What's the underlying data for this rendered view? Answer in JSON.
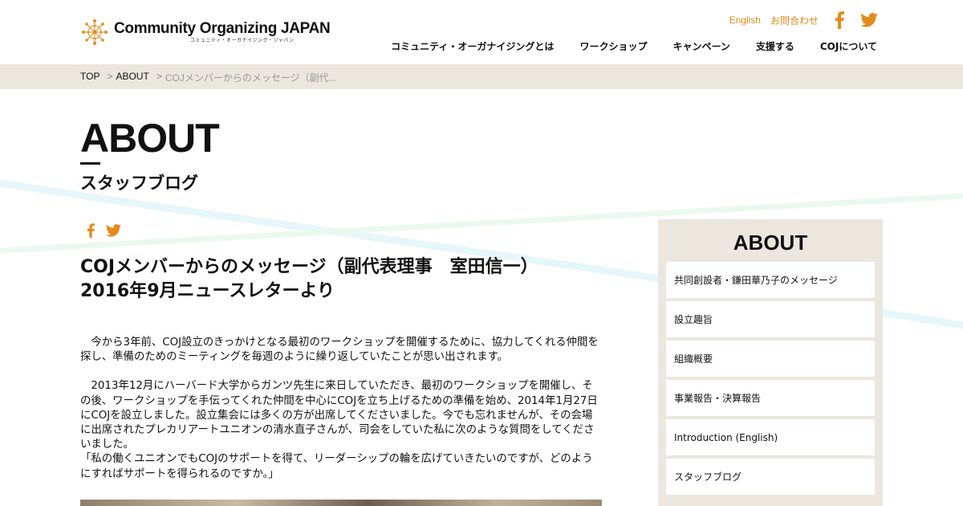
{
  "header": {
    "logo_main": "Community Organizing JAPAN",
    "logo_sub": "コミュニティ・オーガナイジング・ジャパン",
    "util_links": [
      "English",
      "お問合わせ"
    ],
    "icon_colors": {
      "accent": "#e38b1b"
    }
  },
  "nav": {
    "items": [
      "コミュニティ・オーガナイジングとは",
      "ワークショップ",
      "キャンペーン",
      "支援する",
      "COJについて"
    ]
  },
  "breadcrumb": {
    "top": "TOP",
    "about": "ABOUT",
    "current": "COJメンバーからのメッセージ（副代...",
    "sep": ">"
  },
  "page": {
    "title": "ABOUT",
    "subtitle": "スタッフブログ"
  },
  "article": {
    "title_line1": "COJメンバーからのメッセージ（副代表理事　室田信一）",
    "title_line2": "2016年9月ニュースレターより",
    "para1": "　今から3年前、COJ設立のきっかけとなる最初のワークショップを開催するために、協力してくれる仲間を探し、準備のためのミーティングを毎週のように繰り返していたことが思い出されます。",
    "para2": "　2013年12月にハーバード大学からガンツ先生に来日していただき、最初のワークショップを開催し、その後、ワークショップを手伝ってくれた仲間を中心にCOJを立ち上げるための準備を始め、2014年1月27日にCOJを設立しました。設立集会には多くの方が出席してくださいました。今でも忘れませんが、その会場に出席されたプレカリアートユニオンの清水直子さんが、司会をしていた私に次のような質問をしてくださいました。",
    "para3": "「私の働くユニオンでもCOJのサポートを得て、リーダーシップの輪を広げていきたいのですが、どのようにすればサポートを得られるのですか。」"
  },
  "sidebar": {
    "title": "ABOUT",
    "items": [
      "共同創設者・鎌田華乃子のメッセージ",
      "設立趣旨",
      "組織概要",
      "事業報告・決算報告",
      "Introduction (English)",
      "スタッフブログ"
    ]
  }
}
